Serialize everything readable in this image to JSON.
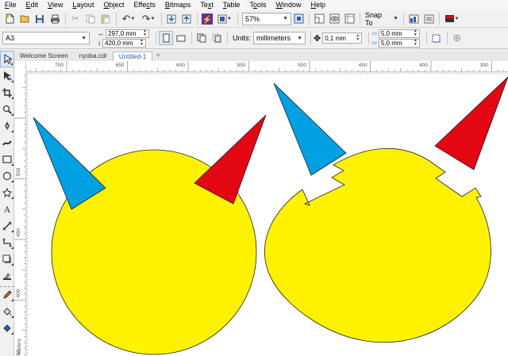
{
  "menu": [
    "File",
    "Edit",
    "View",
    "Layout",
    "Object",
    "Effects",
    "Bitmaps",
    "Text",
    "Table",
    "Tools",
    "Window",
    "Help"
  ],
  "menu_underline": [
    "F",
    "E",
    "V",
    "L",
    "O",
    "c",
    "B",
    "x",
    "T",
    "o",
    "W",
    "H"
  ],
  "toolbar": {
    "zoom": "57%",
    "snap_to": "Snap To"
  },
  "property_bar": {
    "page_size": "A3",
    "width": "297,0 mm",
    "height": "420,0 mm",
    "units_label": "Units:",
    "units": "millimeters",
    "nudge": "0,1 mm",
    "dup_x": "5,0 mm",
    "dup_y": "5,0 mm"
  },
  "tabs": [
    "Welcome Screen",
    "nyoba.cdr",
    "Untitled-1"
  ],
  "active_tab": 2,
  "ruler": {
    "h_labels": [
      "700",
      "650",
      "600",
      "550",
      "500",
      "450",
      "400",
      "350"
    ],
    "v_labels": [
      "500",
      "450",
      "400",
      "350"
    ],
    "v_bottom_label": "meters"
  },
  "colors": {
    "yellow": "#fff200",
    "blue": "#00a0e3",
    "red": "#e30613",
    "accent": "#2a5db0"
  },
  "icons": [
    "new-icon",
    "open-icon",
    "save-icon",
    "print-icon",
    "cut-icon",
    "copy-icon",
    "paste-icon",
    "undo-icon",
    "redo-icon",
    "import-icon",
    "export-icon",
    "publish-pdf-icon",
    "full-screen-icon",
    "wireframe-icon",
    "snap-icon",
    "options-icon",
    "launch-icon"
  ]
}
